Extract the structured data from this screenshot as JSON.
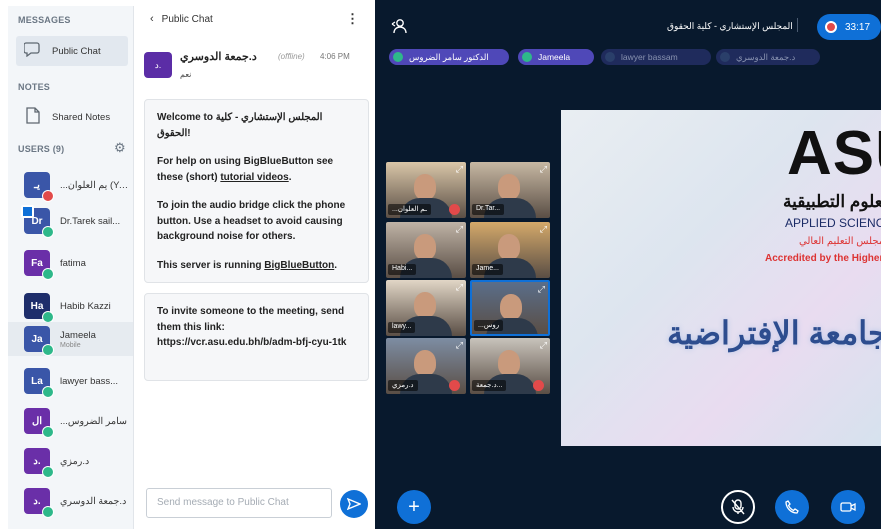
{
  "sidebar": {
    "messages_title": "MESSAGES",
    "public_chat": "Public Chat",
    "notes_title": "NOTES",
    "shared_notes": "Shared Notes",
    "users_title": "USERS (9)",
    "users": [
      {
        "initials": "يـ",
        "name": "...يم العلوان (You)",
        "color": "#3a56a8",
        "mic": "off",
        "sub": ""
      },
      {
        "initials": "Dr",
        "name": "Dr.Tarek sail...",
        "color": "#3a56a8",
        "mic": "on",
        "sub": "",
        "presenter": true
      },
      {
        "initials": "Fa",
        "name": "fatima",
        "color": "#6a2fa8",
        "mic": "on",
        "sub": ""
      },
      {
        "initials": "Ha",
        "name": "Habib Kazzi",
        "color": "#1e2e6b",
        "mic": "on",
        "sub": ""
      },
      {
        "initials": "Ja",
        "name": "Jameela",
        "color": "#3a56a8",
        "mic": "on",
        "sub": "Mobile"
      },
      {
        "initials": "La",
        "name": "lawyer bass...",
        "color": "#3a56a8",
        "mic": "on",
        "sub": ""
      },
      {
        "initials": "ال",
        "name": "...سامر الضروس",
        "color": "#6a2fa8",
        "mic": "on",
        "sub": ""
      },
      {
        "initials": "د.",
        "name": "د.رمزي",
        "color": "#6a2fa8",
        "mic": "on",
        "sub": ""
      },
      {
        "initials": "د.",
        "name": "د.جمعة الدوسري",
        "color": "#6a2fa8",
        "mic": "on",
        "sub": ""
      }
    ]
  },
  "chat": {
    "back_label": "Public Chat",
    "sender": "د.جمعة الدوسري",
    "status": "(offline)",
    "time": "4:06 PM",
    "message": "نعم",
    "avatar": "د.",
    "welcome_line1": "Welcome to المجلس الإستشاري - كلية الحقوق!",
    "welcome_line2a": "For help on using BigBlueButton see these (short) ",
    "welcome_link1": "tutorial videos",
    "welcome_line2b": ".",
    "welcome_line3": "To join the audio bridge click the phone button. Use a headset to avoid causing background noise for others.",
    "welcome_line4a": "This server is running ",
    "welcome_link2": "BigBlueButton",
    "welcome_line4b": ".",
    "invite": "To invite someone to the meeting, send them this link: https://vcr.asu.edu.bh/b/adm-bfj-cyu-1tk",
    "input_placeholder": "Send message to Public Chat"
  },
  "main": {
    "meeting_title": "المجلس الإستشاري - كلية الحقوق",
    "timer": "33:17",
    "talkers": [
      "الدكتور سامر الضروس",
      "Jameela",
      "lawyer bassam",
      "د.جمعة الدوسري"
    ],
    "videos": [
      {
        "label": "...ـم العلوان",
        "mic": "off"
      },
      {
        "label": "Dr.Tar...",
        "mic": "none"
      },
      {
        "label": "Habi...",
        "mic": "none"
      },
      {
        "label": "Jame...",
        "mic": "none"
      },
      {
        "label": "lawy...",
        "mic": "none"
      },
      {
        "label": "...روس",
        "mic": "none"
      },
      {
        "label": "د.رمزي",
        "mic": "off"
      },
      {
        "label": "د.جمعة...",
        "mic": "off"
      }
    ],
    "slide": {
      "big": "ASU",
      "ar1": "جامعة العلوم التطبيقية",
      "en1": "APPLIED SCIENCE",
      "ar2": "معتمدة من مجلس التعليم العالي",
      "en2": "Accredited by the Higher",
      "ar3": "الجامعة الإفتراضية"
    }
  }
}
